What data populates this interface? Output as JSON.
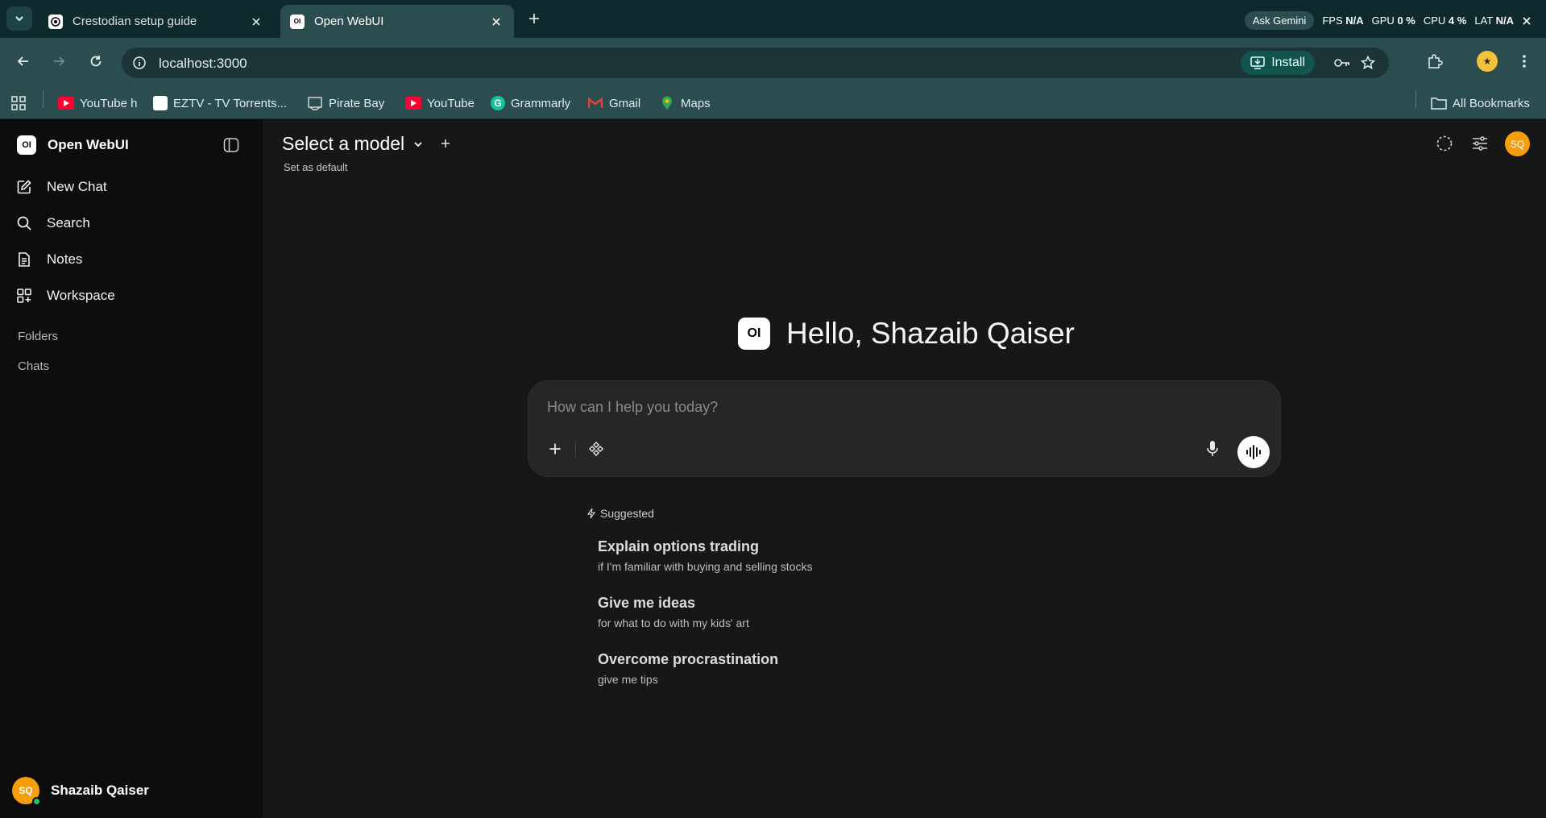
{
  "browser": {
    "tabs": [
      {
        "title": "Crestodian setup guide",
        "active": false
      },
      {
        "title": "Open WebUI",
        "active": true
      }
    ],
    "overlay": {
      "ask_gemini": "Ask Gemini",
      "fps_label": "FPS",
      "fps_value": "N/A",
      "gpu_label": "GPU",
      "gpu_value": "0 %",
      "cpu_label": "CPU",
      "cpu_value": "4 %",
      "lat_label": "LAT",
      "lat_value": "N/A"
    },
    "url": "localhost:3000",
    "install_label": "Install",
    "bookmarks": [
      {
        "label": "YouTube h",
        "icon": "youtube-icon",
        "color": "#ff0033"
      },
      {
        "label": "EZTV - TV Torrents...",
        "icon": "blank-page-icon",
        "color": "#ffffff"
      },
      {
        "label": "Pirate Bay",
        "icon": "pirate-ship-icon",
        "color": "#dddddd"
      },
      {
        "label": "YouTube",
        "icon": "youtube-icon",
        "color": "#ff0033"
      },
      {
        "label": "Grammarly",
        "icon": "grammarly-icon",
        "color": "#15c39a"
      },
      {
        "label": "Gmail",
        "icon": "gmail-icon",
        "color": "#ea4335"
      },
      {
        "label": "Maps",
        "icon": "maps-icon",
        "color": "#34a853"
      }
    ],
    "all_bookmarks": "All Bookmarks"
  },
  "app": {
    "brand": "Open WebUI",
    "logo_text": "OI",
    "nav": [
      {
        "label": "New Chat",
        "icon": "edit-icon"
      },
      {
        "label": "Search",
        "icon": "search-icon"
      },
      {
        "label": "Notes",
        "icon": "notes-icon"
      },
      {
        "label": "Workspace",
        "icon": "workspace-icon"
      }
    ],
    "sections": {
      "folders": "Folders",
      "chats": "Chats"
    },
    "user": {
      "name": "Shazaib Qaiser",
      "initials": "SQ"
    },
    "model_selector": {
      "title": "Select a model",
      "set_default": "Set as default"
    },
    "greeting": "Hello, Shazaib Qaiser",
    "composer": {
      "placeholder": "How can I help you today?"
    },
    "suggested_label": "Suggested",
    "suggestions": [
      {
        "title": "Explain options trading",
        "subtitle": "if I'm familiar with buying and selling stocks"
      },
      {
        "title": "Give me ideas",
        "subtitle": "for what to do with my kids' art"
      },
      {
        "title": "Overcome procrastination",
        "subtitle": "give me tips"
      }
    ],
    "colors": {
      "background": "#171717",
      "sidebar": "#0d0d0d",
      "avatar": "#f59e0b",
      "online": "#22c55e"
    }
  }
}
